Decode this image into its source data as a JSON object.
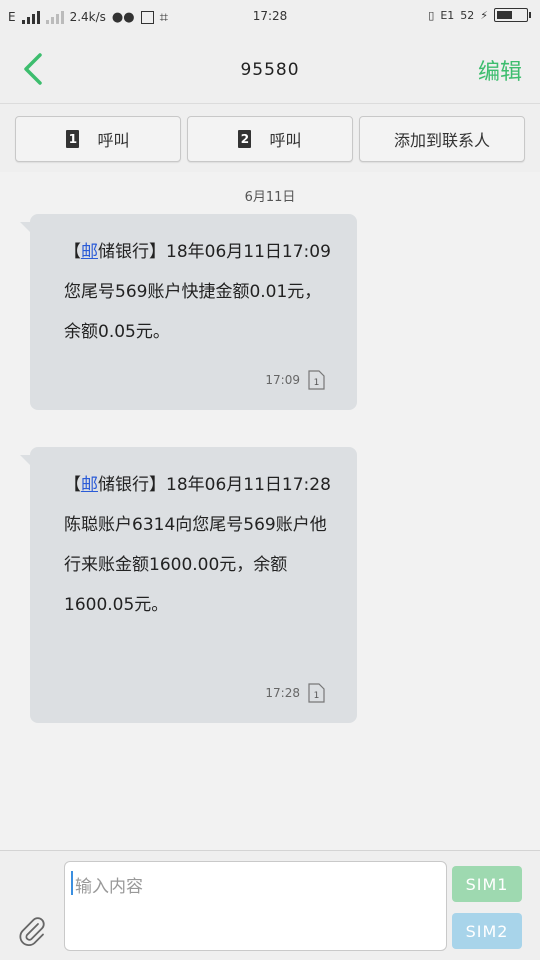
{
  "status_bar": {
    "network_type": "E",
    "speed": "2.4k/s",
    "time": "17:28",
    "network2": "E1",
    "battery": "52",
    "battery_level": 0.52
  },
  "header": {
    "title": "95580",
    "edit_label": "编辑"
  },
  "actions": {
    "call1_num": "1",
    "call1_label": "呼叫",
    "call2_num": "2",
    "call2_label": "呼叫",
    "add_contact_label": "添加到联系人"
  },
  "conversation": {
    "date": "6月11日",
    "messages": [
      {
        "bracket_open": "【",
        "link": "邮",
        "rest": "储银行】18年06月11日17:09您尾号569账户快捷金额0.01元，余额0.05元。",
        "time": "17:09",
        "sim": "1"
      },
      {
        "bracket_open": "【",
        "link": "邮",
        "rest": "储银行】18年06月11日17:28陈聪账户6314向您尾号569账户他行来账金额1600.00元，余额1600.05元。",
        "time": "17:28",
        "sim": "1"
      }
    ]
  },
  "composer": {
    "placeholder": "输入内容",
    "sim1_label": "SIM1",
    "sim2_label": "SIM2"
  },
  "colors": {
    "accent": "#3dbd6e",
    "sim1": "#9ed9b0",
    "sim2": "#a8d4ea",
    "bubble": "#dcdfe2"
  }
}
